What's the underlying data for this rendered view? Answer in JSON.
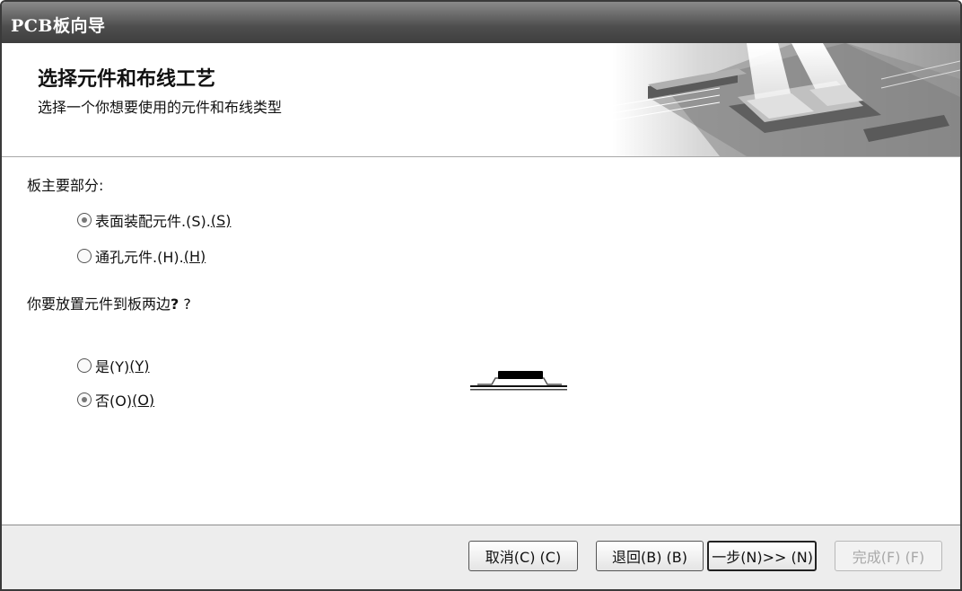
{
  "window": {
    "title": "PCB板向导"
  },
  "header": {
    "title": "选择元件和布线工艺",
    "subtitle": "选择一个你想要使用的元件和布线类型"
  },
  "section1": {
    "label": "板主要部分:",
    "options": [
      {
        "text": "表面装配元件.(S). ",
        "mnemonic": "(S)",
        "selected": true
      },
      {
        "text": "通孔元件.(H). ",
        "mnemonic": "(H)",
        "selected": false
      }
    ]
  },
  "section2": {
    "label": "你要放置元件到板两边",
    "label_q_bold": "?",
    "label_q": "?",
    "options": [
      {
        "text": "是(Y) ",
        "mnemonic": "(Y)",
        "selected": false
      },
      {
        "text": "否(O) ",
        "mnemonic": "(O)",
        "selected": true
      }
    ]
  },
  "footer": {
    "cancel": "取消(C) (C)",
    "back": "退回(B) (B)",
    "next": "一步(N)>> (N)",
    "finish": "完成(F) (F)"
  }
}
